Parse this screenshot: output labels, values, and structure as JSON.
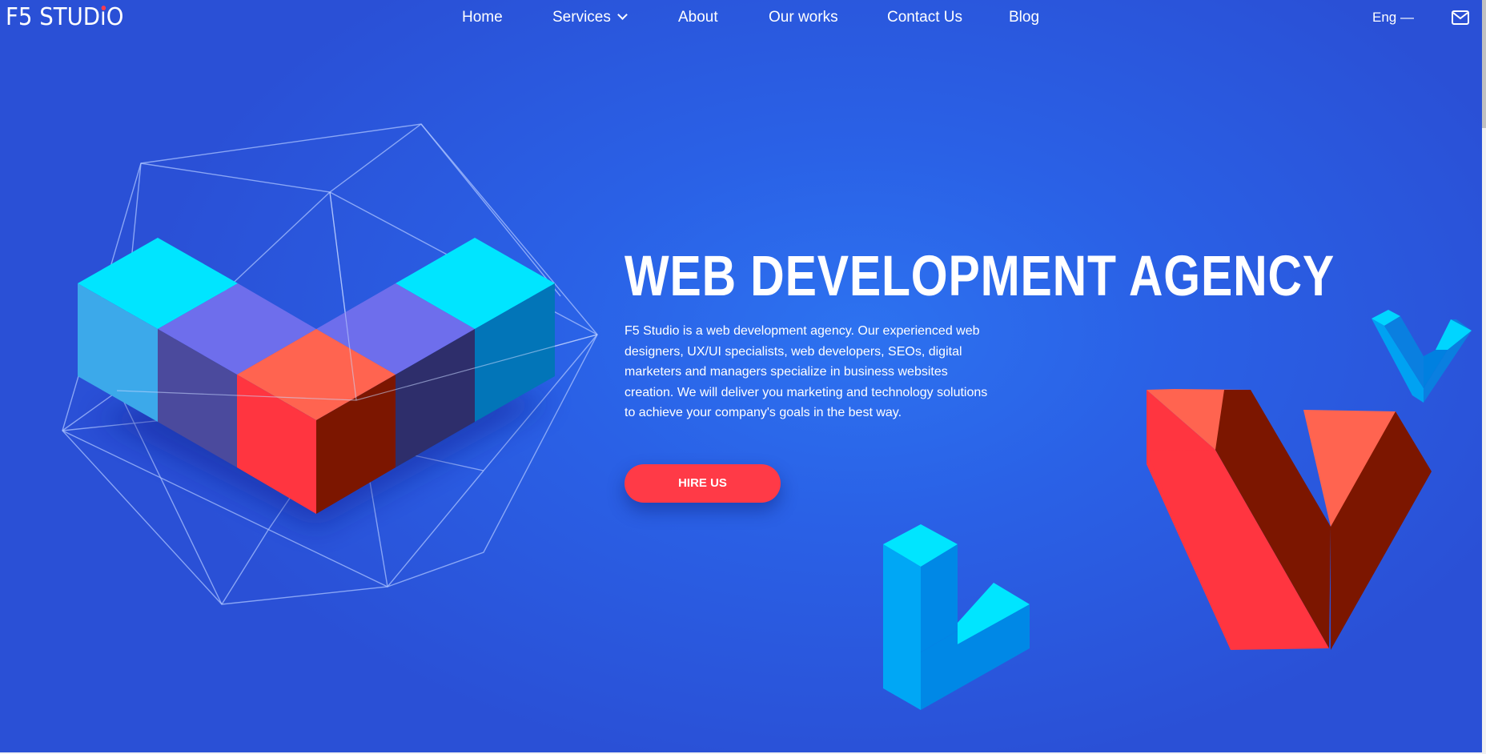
{
  "header": {
    "logo_text": "F5 STUD",
    "logo_last": "O",
    "nav": [
      {
        "label": "Home"
      },
      {
        "label": "Services"
      },
      {
        "label": "About"
      },
      {
        "label": "Our works"
      },
      {
        "label": "Contact Us"
      },
      {
        "label": "Blog"
      }
    ],
    "language": "Eng —",
    "mail_icon": "envelope-icon"
  },
  "hero": {
    "title": "WEB DEVELOPMENT AGENCY",
    "description": "F5 Studio is a web development agency. Our experienced web designers, UX/UI specialists, web developers, SEOs, digital marketers and managers specialize in business websites creation. We will deliver you marketing and technology solutions to achieve your company's goals in the best way.",
    "cta_label": "HIRE US"
  },
  "colors": {
    "background": "#2a5fe4",
    "accent_red": "#ff3a47",
    "cyan": "#00e5ff",
    "purple": "#6f6ff0",
    "dark_red": "#7d1500"
  }
}
